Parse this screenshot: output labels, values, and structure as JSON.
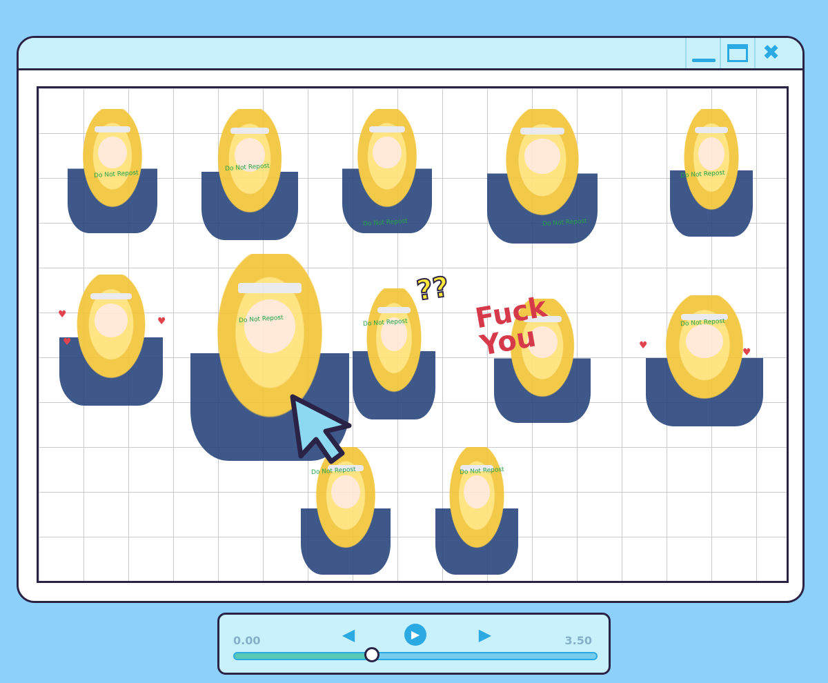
{
  "window": {
    "controls": {
      "minimize": "minimize-icon",
      "maximize": "maximize-icon",
      "close": "close-icon",
      "close_glyph": "✖"
    }
  },
  "canvas": {
    "watermark": "Do Not Repost",
    "sign_text": "Fuck You",
    "question_marks": "??"
  },
  "player": {
    "time_start": "0.00",
    "time_end": "3.50",
    "progress": 0.38,
    "prev_glyph": "◀",
    "play_glyph": "▶",
    "next_glyph": "▶"
  },
  "colors": {
    "background": "#8dd0fa",
    "accent": "#2aa9e3",
    "outline": "#2a2346",
    "titlebar": "#c8f1fb"
  }
}
